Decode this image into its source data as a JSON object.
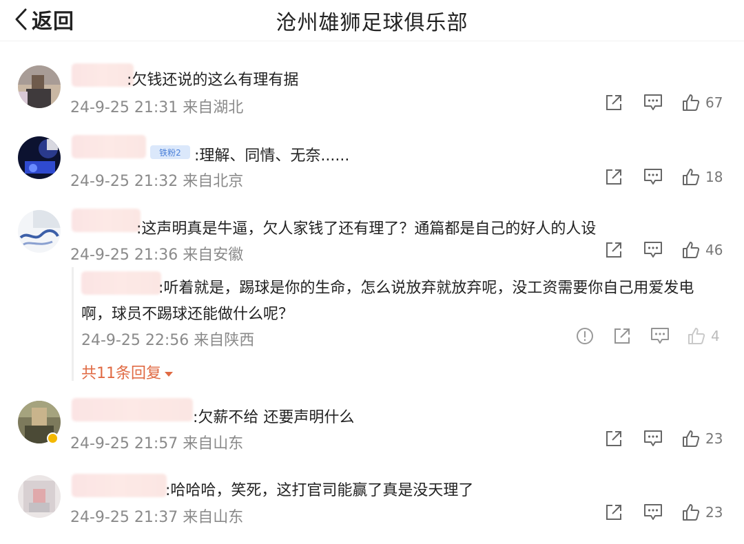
{
  "header": {
    "back_label": "返回",
    "title": "沧州雄狮足球俱乐部"
  },
  "comments": [
    {
      "text": ":欠钱还说的这么有理有据",
      "date": "24-9-25 21:31",
      "location": "来自湖北",
      "likes": "67"
    },
    {
      "badge": "铁粉2",
      "text": ":理解、同情、无奈......",
      "date": "24-9-25 21:32",
      "location": "来自北京",
      "likes": "18"
    },
    {
      "text": ":这声明真是牛逼，欠人家钱了还有理了？通篇都是自己的好人的人设",
      "date": "24-9-25 21:36",
      "location": "来自安徽",
      "likes": "46",
      "reply": {
        "line1": ":听着就是，踢球是你的生命，怎么说放弃就放弃呢，没工资需要你自己用爱发电",
        "line2": "啊，球员不踢球还能做什么呢？",
        "date": "24-9-25 22:56",
        "location": "来自陕西",
        "likes": "4"
      },
      "more_replies": "共11条回复"
    },
    {
      "text": ":欠薪不给 还要声明什么",
      "date": "24-9-25 21:57",
      "location": "来自山东",
      "likes": "23"
    },
    {
      "text": ":哈哈哈，笑死，这打官司能赢了真是没天理了",
      "date": "24-9-25 21:37",
      "location": "来自山东",
      "likes": "23"
    }
  ],
  "colors": {
    "accent": "#e06a43",
    "meta": "#8a8a8a",
    "badge_bg": "#dbe8fb"
  }
}
